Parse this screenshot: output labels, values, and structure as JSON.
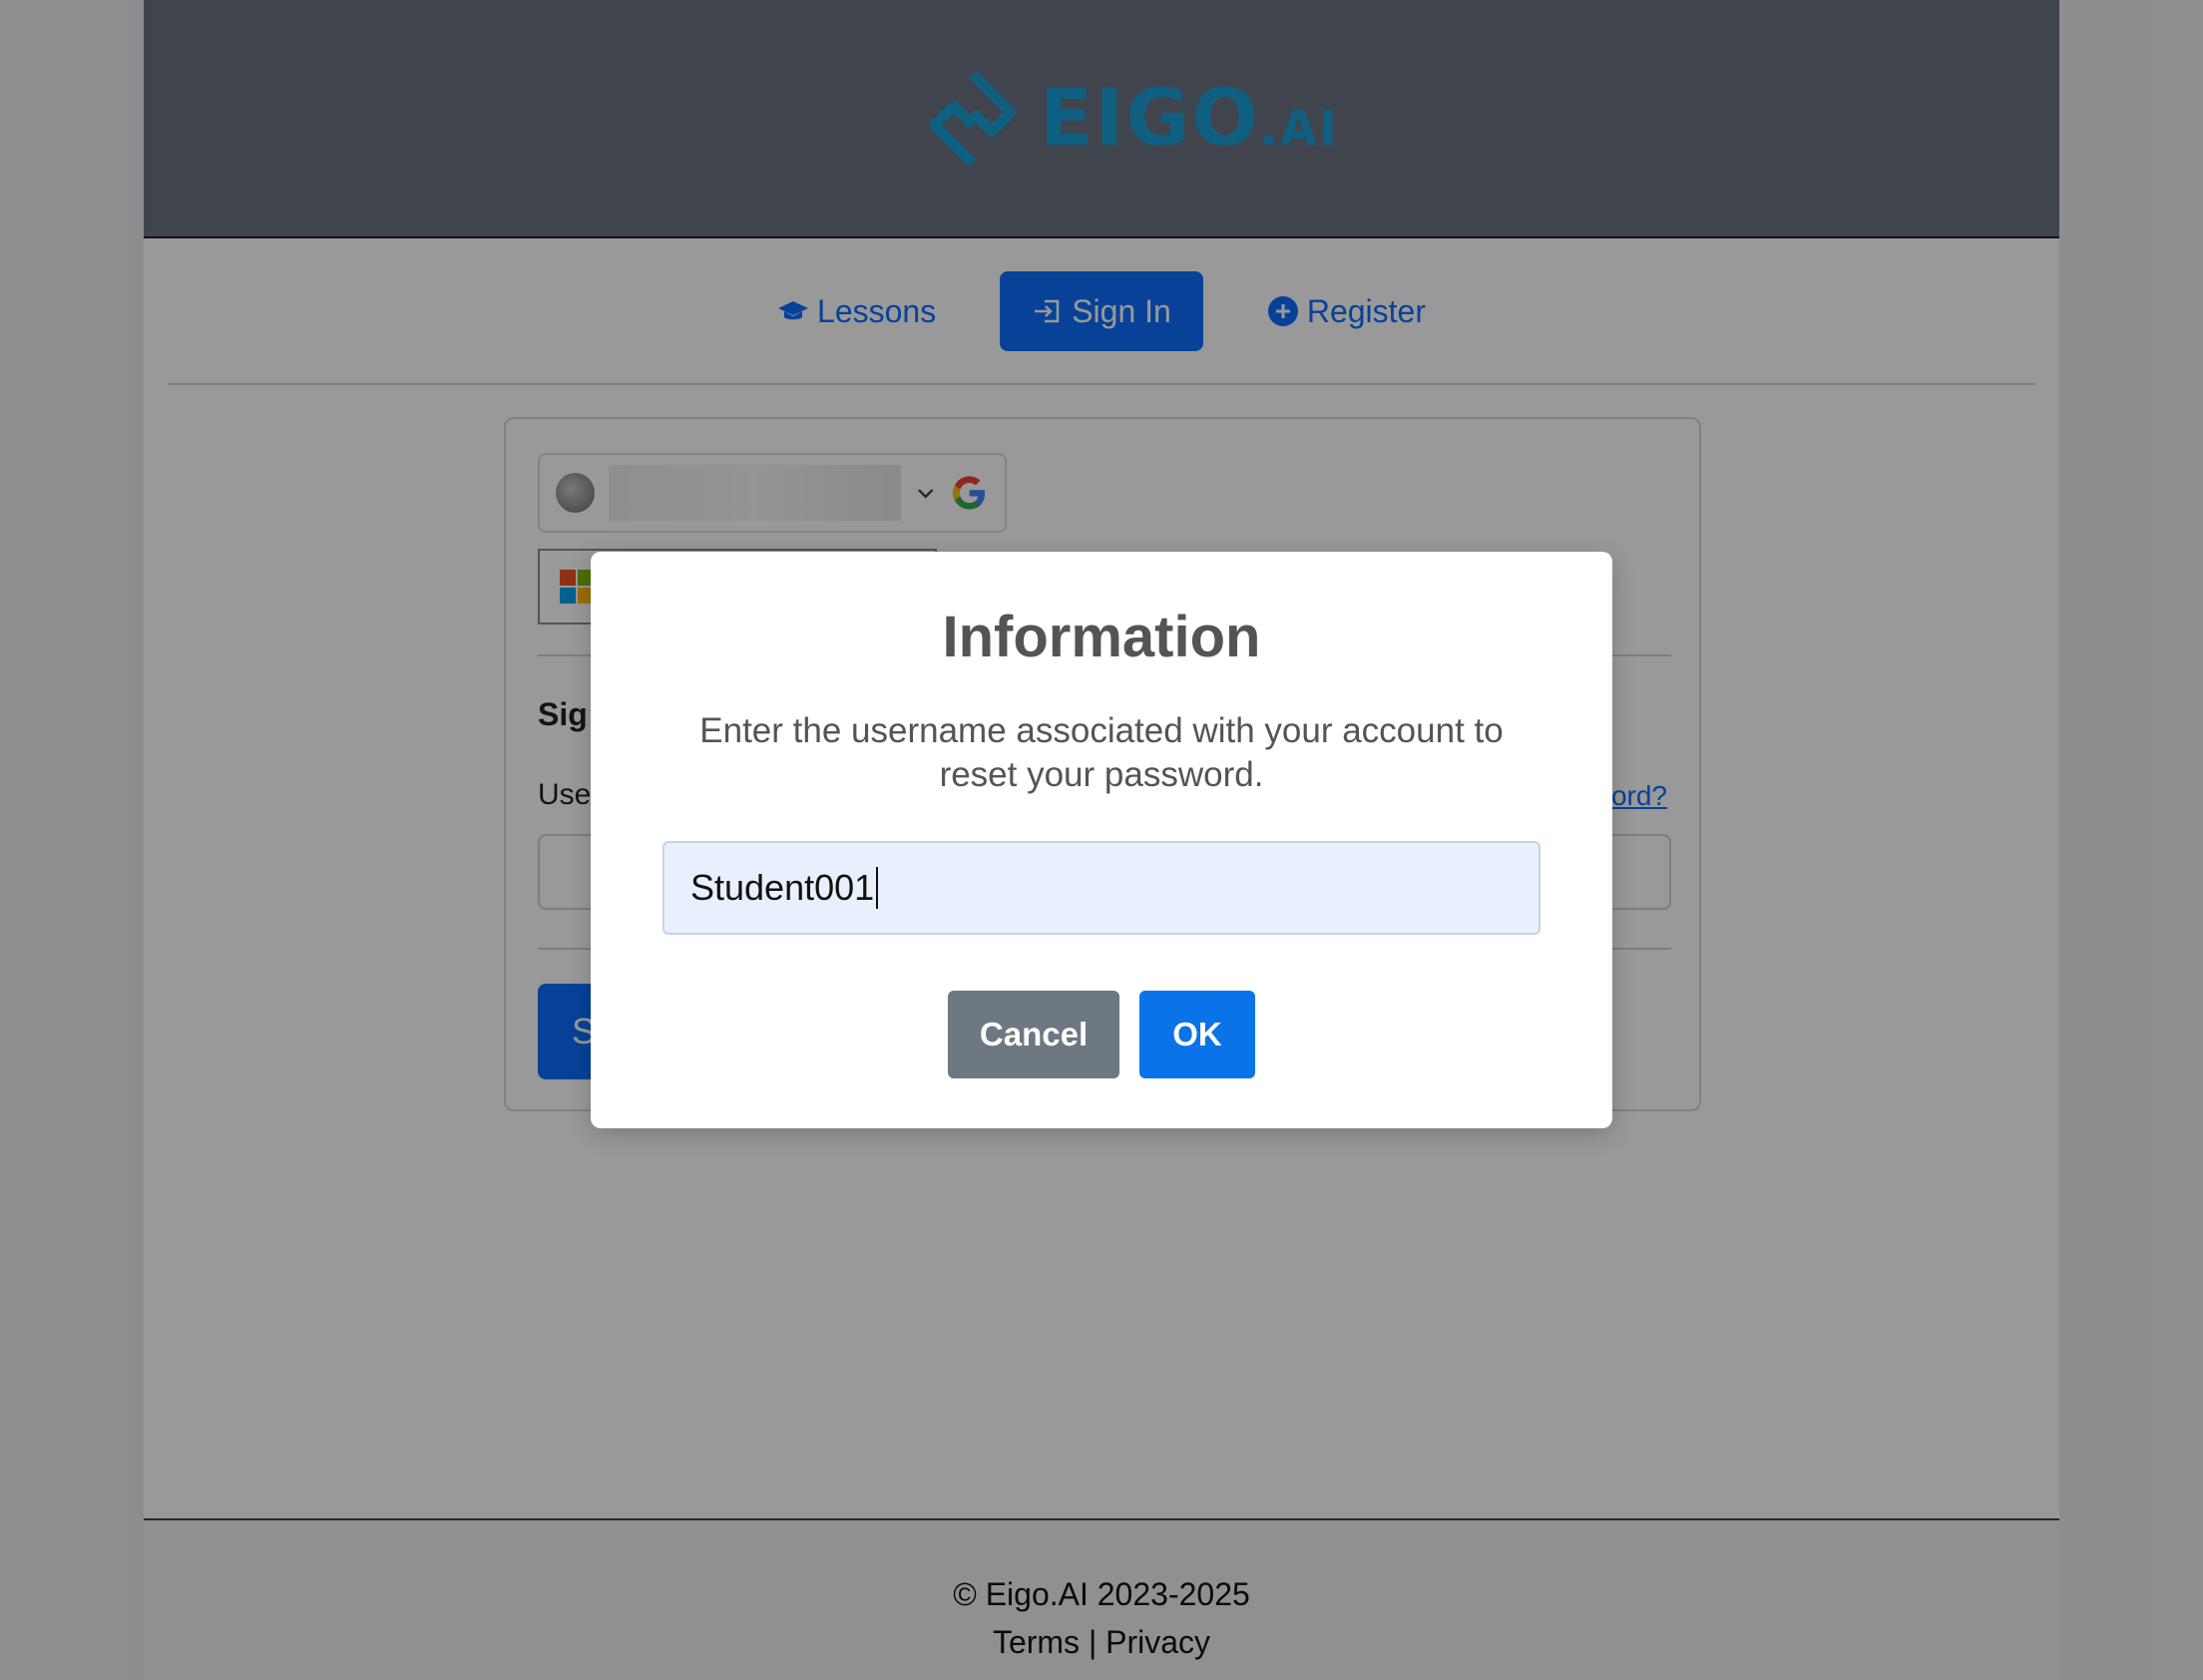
{
  "brand": {
    "logo_text": "EIGO",
    "logo_suffix": ".AI",
    "accent_color": "#1a9fd6"
  },
  "nav": {
    "items": [
      {
        "label": "Lessons",
        "icon": "graduation-cap-icon"
      },
      {
        "label": "Sign In",
        "icon": "sign-in-icon",
        "active": true
      },
      {
        "label": "Register",
        "icon": "plus-circle-icon"
      }
    ]
  },
  "signin_card": {
    "heading": "Sig",
    "username_label": "Use",
    "forgot_link": "ord?",
    "submit_label": "S",
    "google_icon": "google-icon",
    "microsoft_icon": "microsoft-icon"
  },
  "modal": {
    "title": "Information",
    "message": "Enter the username associated with your account to reset your password.",
    "input_value": "Student001",
    "cancel_label": "Cancel",
    "ok_label": "OK"
  },
  "footer": {
    "copyright": "© Eigo.AI 2023-2025",
    "terms": "Terms",
    "separator": "|",
    "privacy": "Privacy"
  }
}
